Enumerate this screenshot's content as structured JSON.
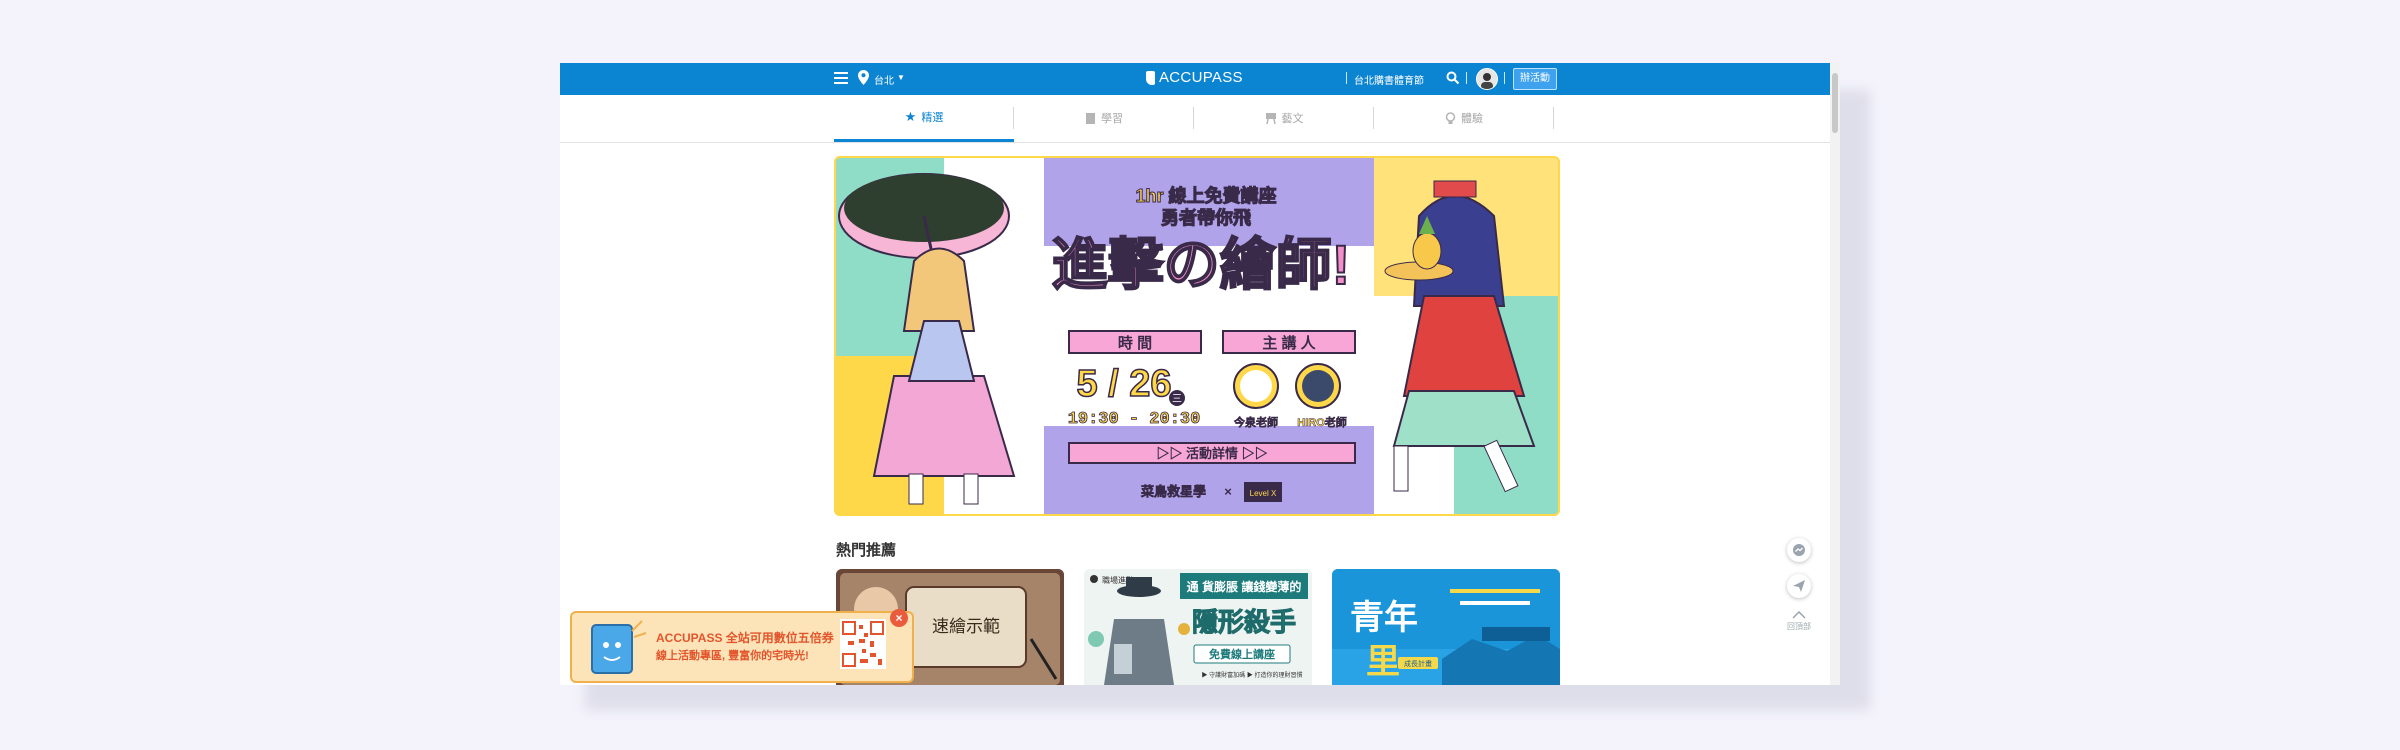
{
  "header": {
    "city": "台北",
    "logo": "ACCUPASS",
    "festival_link": "台北購書體育節",
    "host_button": "辦活動"
  },
  "tabs": [
    {
      "label": "精選",
      "icon": "star-icon",
      "active": true
    },
    {
      "label": "學習",
      "icon": "book-icon",
      "active": false
    },
    {
      "label": "藝文",
      "icon": "easel-icon",
      "active": false
    },
    {
      "label": "體驗",
      "icon": "bulb-icon",
      "active": false
    }
  ],
  "banner": {
    "subtitle_line1": "1hr 線上免費講座",
    "subtitle_line2": "勇者帶你飛",
    "title": "進擊の繪師!",
    "time_label": "時 間",
    "speaker_label": "主 講 人",
    "date": "5 / 26",
    "weekday": "三",
    "time_range": "19:30 - 20:30",
    "speaker1": "今泉老師",
    "speaker2": "HIRO老師",
    "cta": "▷▷ 活動詳情 ▷▷",
    "partner1": "菜鳥救星學",
    "partner_x": "×",
    "partner2": "Level X"
  },
  "section": {
    "popular_title": "熱門推薦"
  },
  "cards": [
    {
      "title": "速繪示範",
      "subtitle": ""
    },
    {
      "badge": "職場進階",
      "line1": "通 貨膨脹 讓錢變薄的",
      "line2": "隱形殺手",
      "line3": "免費線上講座",
      "footer": "▶ 守護財富加碼     ▶ 打造你的理財習慣"
    },
    {
      "big": "青年",
      "big2": "里",
      "tag": "成長計畫"
    }
  ],
  "float": {
    "back_to_top": "回頂部"
  },
  "promo": {
    "line1": "ACCUPASS 全站可用數位五倍券",
    "line2": "線上活動專區, 豐富你的宅時光!",
    "close": "×"
  },
  "colors": {
    "brand": "#0b84d2",
    "banner_pink": "#f08fc2",
    "banner_purple": "#a99be6",
    "banner_teal": "#7fd6c2",
    "banner_yellow": "#ffd84a"
  }
}
